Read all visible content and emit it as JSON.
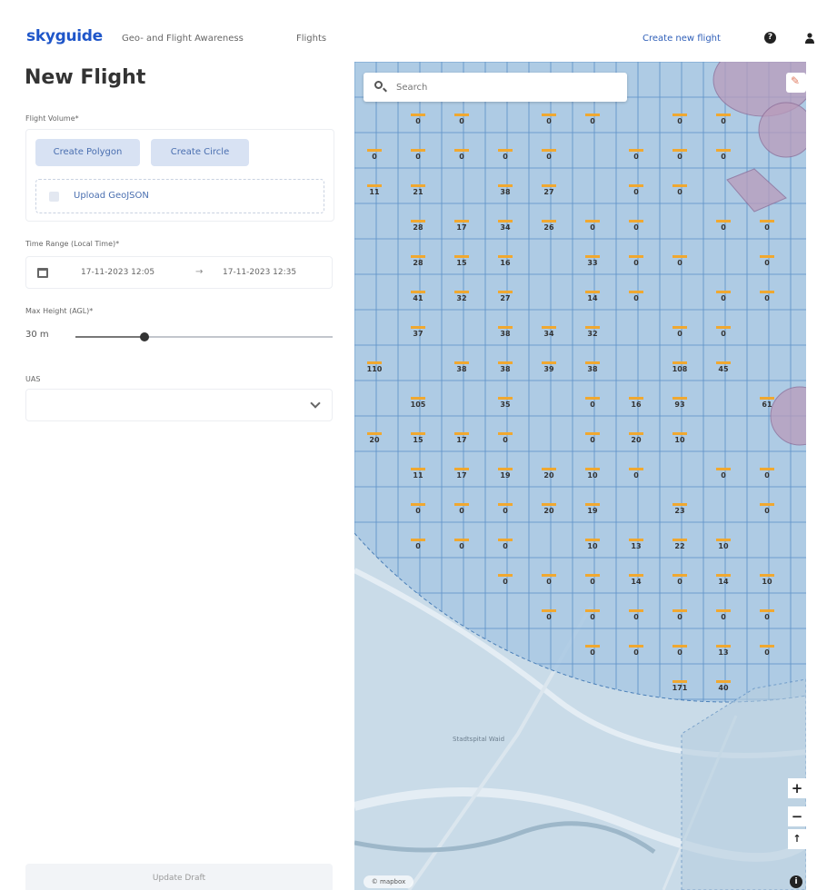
{
  "nav": {
    "logo": "skyguide",
    "geo_link": "Geo- and Flight Awareness",
    "flights_link": "Flights",
    "create_link": "Create new flight",
    "help_icon": "question-icon",
    "user_icon": "user-icon"
  },
  "form": {
    "title": "New Flight",
    "flight_volume_label": "Flight Volume*",
    "create_polygon": "Create Polygon",
    "create_circle": "Create Circle",
    "upload_geojson": "Upload GeoJSON",
    "time_range_label": "Time Range (Local Time)*",
    "time_start": "17-11-2023 12:05",
    "time_arrow": "→",
    "time_end": "17-11-2023 12:35",
    "max_height_label": "Max Height (AGL)*",
    "max_height_value": "30 m",
    "max_height_fraction": 0.27,
    "uas_label": "UAS",
    "uas_value": "",
    "update_button": "Update Draft"
  },
  "map": {
    "search_placeholder": "Search",
    "zoom_in": "+",
    "zoom_out": "−",
    "compass": "↑",
    "info": "i",
    "attribution": "© mapbox",
    "place_label": "Stadtspital Waid",
    "colors": {
      "grid_fill": "#a9c8e3",
      "grid_line": "#5a8fc7",
      "bar": "#f0a830",
      "zone": "#b99bbb"
    },
    "cells": [
      {
        "r": 1,
        "c": 1,
        "v": "0"
      },
      {
        "r": 1,
        "c": 2,
        "v": "0"
      },
      {
        "r": 1,
        "c": 4,
        "v": "0"
      },
      {
        "r": 1,
        "c": 5,
        "v": "0"
      },
      {
        "r": 1,
        "c": 7,
        "v": "0"
      },
      {
        "r": 1,
        "c": 8,
        "v": "0"
      },
      {
        "r": 2,
        "c": 0,
        "v": "0"
      },
      {
        "r": 2,
        "c": 1,
        "v": "0"
      },
      {
        "r": 2,
        "c": 2,
        "v": "0"
      },
      {
        "r": 2,
        "c": 3,
        "v": "0"
      },
      {
        "r": 2,
        "c": 4,
        "v": "0"
      },
      {
        "r": 2,
        "c": 6,
        "v": "0"
      },
      {
        "r": 2,
        "c": 7,
        "v": "0"
      },
      {
        "r": 2,
        "c": 8,
        "v": "0"
      },
      {
        "r": 3,
        "c": 0,
        "v": "11"
      },
      {
        "r": 3,
        "c": 1,
        "v": "21"
      },
      {
        "r": 3,
        "c": 3,
        "v": "38"
      },
      {
        "r": 3,
        "c": 4,
        "v": "27"
      },
      {
        "r": 3,
        "c": 6,
        "v": "0"
      },
      {
        "r": 3,
        "c": 7,
        "v": "0"
      },
      {
        "r": 4,
        "c": 1,
        "v": "28"
      },
      {
        "r": 4,
        "c": 2,
        "v": "17"
      },
      {
        "r": 4,
        "c": 3,
        "v": "34"
      },
      {
        "r": 4,
        "c": 4,
        "v": "26"
      },
      {
        "r": 4,
        "c": 5,
        "v": "0"
      },
      {
        "r": 4,
        "c": 6,
        "v": "0"
      },
      {
        "r": 4,
        "c": 8,
        "v": "0"
      },
      {
        "r": 4,
        "c": 9,
        "v": "0"
      },
      {
        "r": 5,
        "c": 1,
        "v": "28"
      },
      {
        "r": 5,
        "c": 2,
        "v": "15"
      },
      {
        "r": 5,
        "c": 3,
        "v": "16"
      },
      {
        "r": 5,
        "c": 5,
        "v": "33"
      },
      {
        "r": 5,
        "c": 6,
        "v": "0"
      },
      {
        "r": 5,
        "c": 7,
        "v": "0"
      },
      {
        "r": 5,
        "c": 9,
        "v": "0"
      },
      {
        "r": 6,
        "c": 1,
        "v": "41"
      },
      {
        "r": 6,
        "c": 2,
        "v": "32"
      },
      {
        "r": 6,
        "c": 3,
        "v": "27"
      },
      {
        "r": 6,
        "c": 5,
        "v": "14"
      },
      {
        "r": 6,
        "c": 6,
        "v": "0"
      },
      {
        "r": 6,
        "c": 8,
        "v": "0"
      },
      {
        "r": 6,
        "c": 9,
        "v": "0"
      },
      {
        "r": 7,
        "c": 1,
        "v": "37"
      },
      {
        "r": 7,
        "c": 3,
        "v": "38"
      },
      {
        "r": 7,
        "c": 4,
        "v": "34"
      },
      {
        "r": 7,
        "c": 5,
        "v": "32"
      },
      {
        "r": 7,
        "c": 7,
        "v": "0"
      },
      {
        "r": 7,
        "c": 8,
        "v": "0"
      },
      {
        "r": 8,
        "c": 0,
        "v": "110"
      },
      {
        "r": 8,
        "c": 2,
        "v": "38"
      },
      {
        "r": 8,
        "c": 3,
        "v": "38"
      },
      {
        "r": 8,
        "c": 4,
        "v": "39"
      },
      {
        "r": 8,
        "c": 5,
        "v": "38"
      },
      {
        "r": 8,
        "c": 7,
        "v": "108"
      },
      {
        "r": 8,
        "c": 8,
        "v": "45"
      },
      {
        "r": 9,
        "c": 1,
        "v": "105"
      },
      {
        "r": 9,
        "c": 3,
        "v": "35"
      },
      {
        "r": 9,
        "c": 5,
        "v": "0"
      },
      {
        "r": 9,
        "c": 6,
        "v": "16"
      },
      {
        "r": 9,
        "c": 7,
        "v": "93"
      },
      {
        "r": 9,
        "c": 9,
        "v": "61"
      },
      {
        "r": 10,
        "c": 0,
        "v": "20"
      },
      {
        "r": 10,
        "c": 1,
        "v": "15"
      },
      {
        "r": 10,
        "c": 2,
        "v": "17"
      },
      {
        "r": 10,
        "c": 3,
        "v": "0"
      },
      {
        "r": 10,
        "c": 5,
        "v": "0"
      },
      {
        "r": 10,
        "c": 6,
        "v": "20"
      },
      {
        "r": 10,
        "c": 7,
        "v": "10"
      },
      {
        "r": 11,
        "c": 1,
        "v": "11"
      },
      {
        "r": 11,
        "c": 2,
        "v": "17"
      },
      {
        "r": 11,
        "c": 3,
        "v": "19"
      },
      {
        "r": 11,
        "c": 4,
        "v": "20"
      },
      {
        "r": 11,
        "c": 5,
        "v": "10"
      },
      {
        "r": 11,
        "c": 6,
        "v": "0"
      },
      {
        "r": 11,
        "c": 8,
        "v": "0"
      },
      {
        "r": 11,
        "c": 9,
        "v": "0"
      },
      {
        "r": 12,
        "c": 1,
        "v": "0"
      },
      {
        "r": 12,
        "c": 2,
        "v": "0"
      },
      {
        "r": 12,
        "c": 3,
        "v": "0"
      },
      {
        "r": 12,
        "c": 4,
        "v": "20"
      },
      {
        "r": 12,
        "c": 5,
        "v": "19"
      },
      {
        "r": 12,
        "c": 7,
        "v": "23"
      },
      {
        "r": 12,
        "c": 9,
        "v": "0"
      },
      {
        "r": 13,
        "c": 1,
        "v": "0"
      },
      {
        "r": 13,
        "c": 2,
        "v": "0"
      },
      {
        "r": 13,
        "c": 3,
        "v": "0"
      },
      {
        "r": 13,
        "c": 5,
        "v": "10"
      },
      {
        "r": 13,
        "c": 6,
        "v": "13"
      },
      {
        "r": 13,
        "c": 7,
        "v": "22"
      },
      {
        "r": 13,
        "c": 8,
        "v": "10"
      },
      {
        "r": 14,
        "c": 3,
        "v": "0"
      },
      {
        "r": 14,
        "c": 4,
        "v": "0"
      },
      {
        "r": 14,
        "c": 5,
        "v": "0"
      },
      {
        "r": 14,
        "c": 6,
        "v": "14"
      },
      {
        "r": 14,
        "c": 7,
        "v": "0"
      },
      {
        "r": 14,
        "c": 8,
        "v": "14"
      },
      {
        "r": 14,
        "c": 9,
        "v": "10"
      },
      {
        "r": 15,
        "c": 4,
        "v": "0"
      },
      {
        "r": 15,
        "c": 5,
        "v": "0"
      },
      {
        "r": 15,
        "c": 6,
        "v": "0"
      },
      {
        "r": 15,
        "c": 7,
        "v": "0"
      },
      {
        "r": 15,
        "c": 8,
        "v": "0"
      },
      {
        "r": 15,
        "c": 9,
        "v": "0"
      },
      {
        "r": 16,
        "c": 5,
        "v": "0"
      },
      {
        "r": 16,
        "c": 6,
        "v": "0"
      },
      {
        "r": 16,
        "c": 7,
        "v": "0"
      },
      {
        "r": 16,
        "c": 8,
        "v": "13"
      },
      {
        "r": 16,
        "c": 9,
        "v": "0"
      },
      {
        "r": 17,
        "c": 7,
        "v": "171"
      },
      {
        "r": 17,
        "c": 8,
        "v": "40"
      }
    ]
  }
}
